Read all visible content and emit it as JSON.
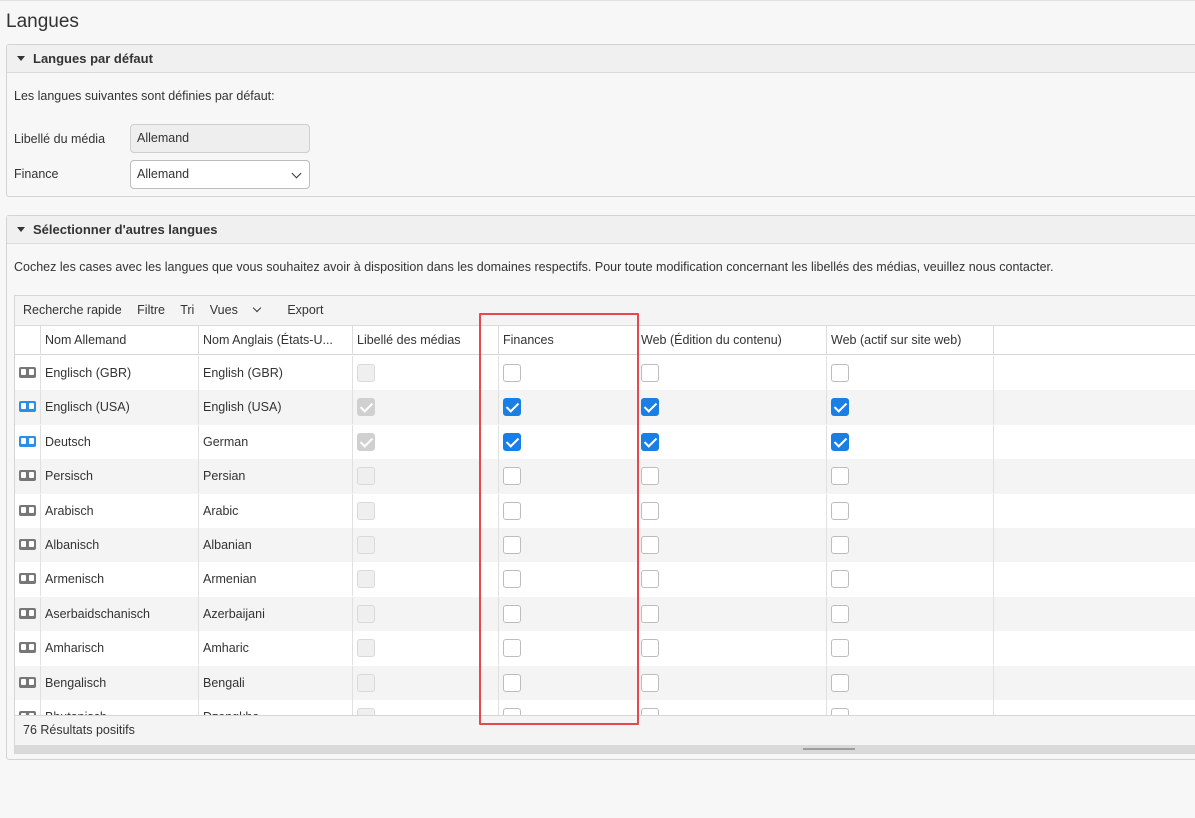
{
  "page": {
    "title": "Langues"
  },
  "defaults_panel": {
    "title": "Langues par défaut",
    "intro": "Les langues suivantes sont définies par défaut:",
    "media_label": "Libellé du média",
    "media_value": "Allemand",
    "finance_label": "Finance",
    "finance_value": "Allemand"
  },
  "other_panel": {
    "title": "Sélectionner d'autres langues",
    "intro": "Cochez les cases avec les langues que vous souhaitez avoir à disposition dans les domaines respectifs. Pour toute modification concernant les libellés des médias, veuillez nous contacter."
  },
  "toolbar": {
    "quick_search": "Recherche rapide",
    "filter": "Filtre",
    "sort": "Tri",
    "views": "Vues",
    "export": "Export"
  },
  "columns": {
    "name_de": "Nom Allemand",
    "name_en": "Nom Anglais (États-U...",
    "media": "Libellé des médias",
    "finances": "Finances",
    "web_edit": "Web (Édition du contenu)",
    "web_live": "Web (actif sur site web)"
  },
  "rows": [
    {
      "name_de": "Englisch (GBR)",
      "name_en": "English (GBR)",
      "active": false,
      "media": false,
      "finances": false,
      "web_edit": false,
      "web_live": false
    },
    {
      "name_de": "Englisch (USA)",
      "name_en": "English (USA)",
      "active": true,
      "media": true,
      "finances": true,
      "web_edit": true,
      "web_live": true
    },
    {
      "name_de": "Deutsch",
      "name_en": "German",
      "active": true,
      "media": true,
      "finances": true,
      "web_edit": true,
      "web_live": true
    },
    {
      "name_de": "Persisch",
      "name_en": "Persian",
      "active": false,
      "media": false,
      "finances": false,
      "web_edit": false,
      "web_live": false
    },
    {
      "name_de": "Arabisch",
      "name_en": "Arabic",
      "active": false,
      "media": false,
      "finances": false,
      "web_edit": false,
      "web_live": false
    },
    {
      "name_de": "Albanisch",
      "name_en": "Albanian",
      "active": false,
      "media": false,
      "finances": false,
      "web_edit": false,
      "web_live": false
    },
    {
      "name_de": "Armenisch",
      "name_en": "Armenian",
      "active": false,
      "media": false,
      "finances": false,
      "web_edit": false,
      "web_live": false
    },
    {
      "name_de": "Aserbaidschanisch",
      "name_en": "Azerbaijani",
      "active": false,
      "media": false,
      "finances": false,
      "web_edit": false,
      "web_live": false
    },
    {
      "name_de": "Amharisch",
      "name_en": "Amharic",
      "active": false,
      "media": false,
      "finances": false,
      "web_edit": false,
      "web_live": false
    },
    {
      "name_de": "Bengalisch",
      "name_en": "Bengali",
      "active": false,
      "media": false,
      "finances": false,
      "web_edit": false,
      "web_live": false
    },
    {
      "name_de": "Bhutanisch",
      "name_en": "Dzongkha",
      "active": false,
      "media": false,
      "finances": false,
      "web_edit": false,
      "web_live": false
    }
  ],
  "footer": {
    "result_count": "76 Résultats positifs"
  },
  "colors": {
    "accent": "#1a7fe5",
    "highlight": "#e5484d",
    "icon_active": "#2a8fea",
    "icon_inactive": "#777777"
  },
  "icons": {
    "row_icon": "language-card-icon",
    "collapse": "caret-down-icon",
    "dropdown": "chevron-down-icon"
  }
}
